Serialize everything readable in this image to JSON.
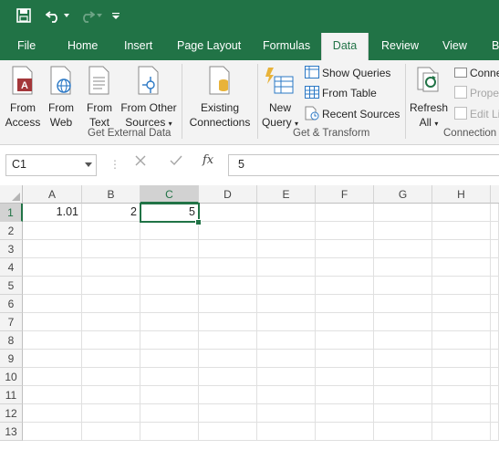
{
  "colors": {
    "accent": "#217346",
    "ribbon_bg": "#f3f3f3"
  },
  "qat": {
    "save_icon": "save-icon",
    "undo_icon": "undo-icon",
    "redo_icon": "redo-icon",
    "customize_icon": "customize-qat-icon"
  },
  "tabs": [
    {
      "label": "File"
    },
    {
      "label": "Home"
    },
    {
      "label": "Insert"
    },
    {
      "label": "Page Layout"
    },
    {
      "label": "Formulas"
    },
    {
      "label": "Data",
      "active": true
    },
    {
      "label": "Review"
    },
    {
      "label": "View"
    },
    {
      "label": "B"
    }
  ],
  "ribbon": {
    "get_external": {
      "label": "Get External Data",
      "from_access": [
        "From",
        "Access"
      ],
      "from_web": [
        "From",
        "Web"
      ],
      "from_text": [
        "From",
        "Text"
      ],
      "from_other": [
        "From Other",
        "Sources"
      ]
    },
    "existing": [
      "Existing",
      "Connections"
    ],
    "get_transform": {
      "label": "Get & Transform",
      "new_query": [
        "New",
        "Query"
      ],
      "show_queries": "Show Queries",
      "from_table": "From Table",
      "recent_sources": "Recent Sources"
    },
    "connections": {
      "label": "Connection",
      "refresh": [
        "Refresh",
        "All"
      ],
      "connections": "Conne",
      "properties": "Prope",
      "edit_links": "Edit Li"
    }
  },
  "formula_bar": {
    "name_box": "C1",
    "fx": "fx",
    "value": "5"
  },
  "sheet": {
    "columns": [
      "A",
      "B",
      "C",
      "D",
      "E",
      "F",
      "G",
      "H"
    ],
    "selected_column": "C",
    "rows": [
      "1",
      "2",
      "3",
      "4",
      "5",
      "6",
      "7",
      "8",
      "9",
      "10",
      "11",
      "12",
      "13"
    ],
    "selected_row": "1",
    "cells": {
      "A1": "1.01",
      "B1": "2",
      "C1": "5"
    }
  }
}
